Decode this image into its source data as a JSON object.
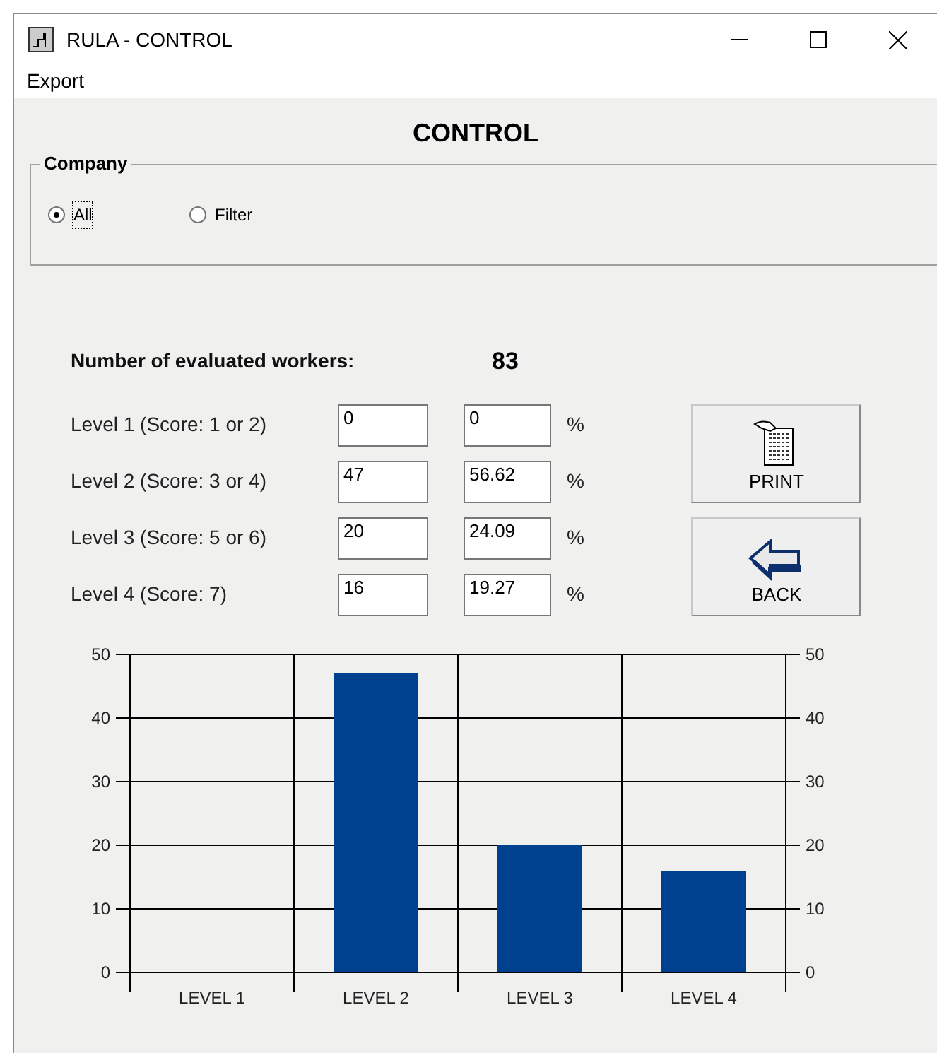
{
  "window": {
    "title": "RULA - CONTROL"
  },
  "menu": [
    "Export"
  ],
  "heading": "CONTROL",
  "company": {
    "legend": "Company",
    "options": [
      {
        "label": "All",
        "selected": true
      },
      {
        "label": "Filter",
        "selected": false
      }
    ]
  },
  "workers": {
    "label": "Number of evaluated workers:",
    "value": "83"
  },
  "levels": [
    {
      "label": "Level 1 (Score: 1 or 2)",
      "count": "0",
      "percent": "0",
      "unit": "%"
    },
    {
      "label": "Level 2 (Score: 3 or 4)",
      "count": "47",
      "percent": "56.62",
      "unit": "%"
    },
    {
      "label": "Level 3 (Score: 5 or 6)",
      "count": "20",
      "percent": "24.09",
      "unit": "%"
    },
    {
      "label": "Level 4 (Score: 7)",
      "count": "16",
      "percent": "19.27",
      "unit": "%"
    }
  ],
  "buttons": [
    {
      "label": "PRINT",
      "kind": "print"
    },
    {
      "label": "BACK",
      "kind": "back"
    }
  ],
  "chart_data": {
    "type": "bar",
    "categories": [
      "LEVEL 1",
      "LEVEL 2",
      "LEVEL 3",
      "LEVEL 4"
    ],
    "series": [
      {
        "color": "#00418f",
        "values": [
          0,
          47,
          20,
          16
        ]
      }
    ],
    "ylim": [
      0,
      50
    ],
    "yticks": [
      0,
      10,
      20,
      30,
      40,
      50
    ],
    "y2ticks": [
      0,
      10,
      20,
      30,
      40,
      50
    ],
    "y2lim": [
      0,
      50
    ],
    "grid": true
  }
}
